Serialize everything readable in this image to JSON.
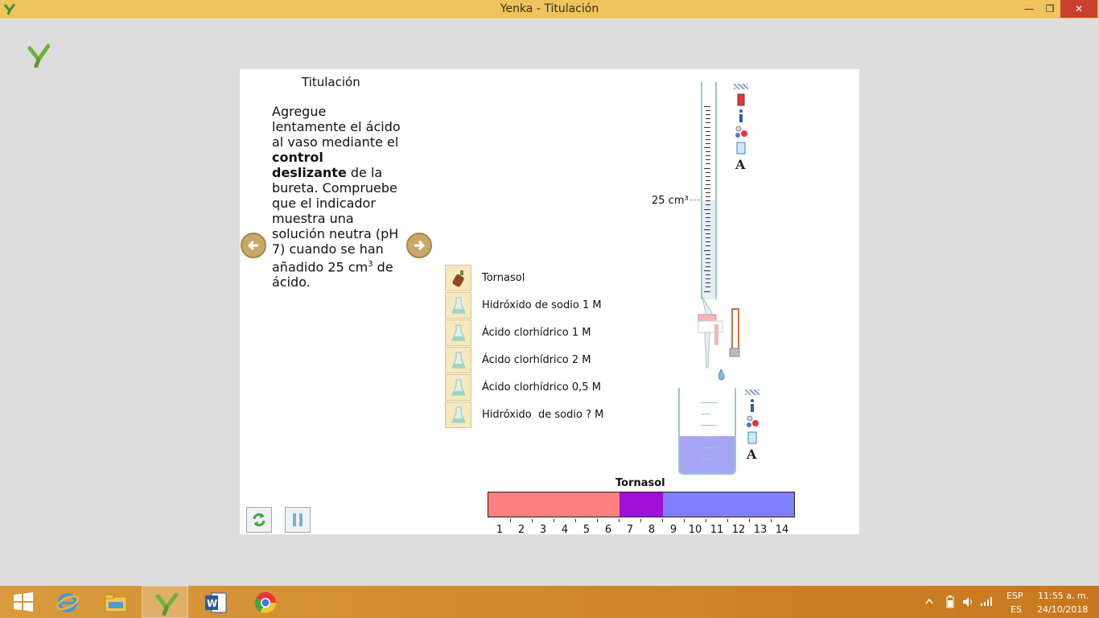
{
  "window": {
    "title": "Yenka - Titulación"
  },
  "instructions": {
    "title": "Titulación",
    "text_before_bold": "Agregue lentamente el ácido al vaso mediante el ",
    "bold": "control deslizante",
    "text_after_bold": " de la bureta. Compruebe que el indicador muestra una solución neutra (pH 7) cuando se han añadido 25 cm",
    "superscript": "3",
    "text_end": " de ácido."
  },
  "chemicals": [
    {
      "label": "Tornasol",
      "icon": "indicator-bottle-icon"
    },
    {
      "label": "Hidróxido de sodio 1 M",
      "icon": "flask-icon"
    },
    {
      "label": "Ácido clorhídrico 1 M",
      "icon": "flask-icon"
    },
    {
      "label": "Ácido clorhídrico 2 M",
      "icon": "flask-icon"
    },
    {
      "label": "Ácido clorhídrico 0,5 M",
      "icon": "flask-icon"
    },
    {
      "label": "Hidróxido  de sodio ? M",
      "icon": "flask-icon"
    }
  ],
  "burette": {
    "volume_label": "25 cm³"
  },
  "ph_scale": {
    "title": "Tornasol",
    "numbers": [
      "1",
      "2",
      "3",
      "4",
      "5",
      "6",
      "7",
      "8",
      "9",
      "10",
      "11",
      "12",
      "13",
      "14"
    ],
    "colors": {
      "acid": "#ff8080",
      "neutral": "#a010d8",
      "alkaline": "#8080ff"
    }
  },
  "beaker": {
    "liquid_color": "#a7a6f6"
  },
  "colors": {
    "titlebar": "#f0c45c",
    "taskbar": "#d08a2c"
  },
  "tray": {
    "lang_top": "ESP",
    "lang_bottom": "ES",
    "time": "11:55 a. m.",
    "date": "24/10/2018"
  }
}
